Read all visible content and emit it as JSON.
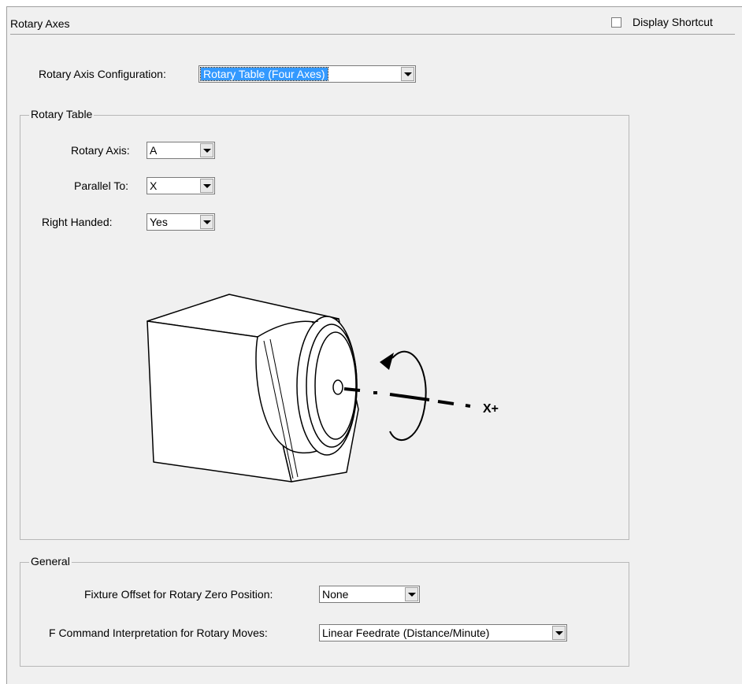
{
  "header": {
    "title": "Rotary Axes",
    "display_shortcut_label": "Display Shortcut"
  },
  "config": {
    "label": "Rotary Axis Configuration:",
    "value": "Rotary Table (Four Axes)"
  },
  "rotary_table": {
    "group_title": "Rotary Table",
    "rotary_axis_label": "Rotary Axis:",
    "rotary_axis_value": "A",
    "parallel_to_label": "Parallel To:",
    "parallel_to_value": "X",
    "right_handed_label": "Right Handed:",
    "right_handed_value": "Yes",
    "diagram_axis_label": "X+"
  },
  "general": {
    "group_title": "General",
    "fixture_offset_label": "Fixture Offset for Rotary Zero Position:",
    "fixture_offset_value": "None",
    "f_command_label": "F Command Interpretation for Rotary Moves:",
    "f_command_value": "Linear Feedrate (Distance/Minute)"
  },
  "icons": [
    "dropdown-arrow-icon",
    "rotation-arrow-icon"
  ]
}
